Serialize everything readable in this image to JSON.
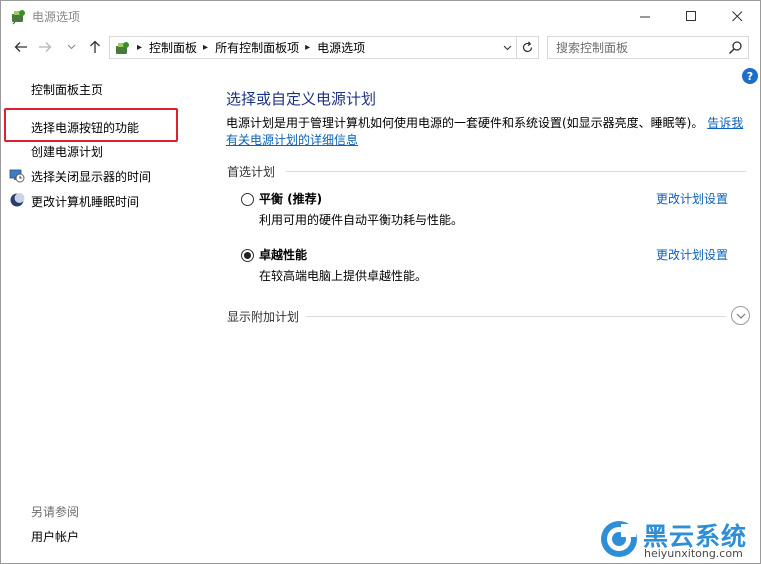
{
  "window": {
    "title": "电源选项",
    "icon": "power-options-icon"
  },
  "address_bar": {
    "breadcrumbs": [
      "控制面板",
      "所有控制面板项",
      "电源选项"
    ],
    "search_placeholder": "搜索控制面板"
  },
  "sidebar": {
    "home": "控制面板主页",
    "links": [
      {
        "label": "选择电源按钮的功能",
        "highlighted": true
      },
      {
        "label": "创建电源计划"
      },
      {
        "label": "选择关闭显示器的时间",
        "icon": "monitor-clock-icon"
      },
      {
        "label": "更改计算机睡眠时间",
        "icon": "moon-icon"
      }
    ],
    "see_also_label": "另请参阅",
    "see_also_items": [
      "用户帐户"
    ]
  },
  "main": {
    "title": "选择或自定义电源计划",
    "description": "电源计划是用于管理计算机如何使用电源的一套硬件和系统设置(如显示器亮度、睡眠等)。",
    "description_link": "告诉我有关电源计划的详细信息",
    "preferred_plans_label": "首选计划",
    "plans": [
      {
        "name": "平衡 (推荐)",
        "description": "利用可用的硬件自动平衡功耗与性能。",
        "selected": false,
        "link": "更改计划设置"
      },
      {
        "name": "卓越性能",
        "description": "在较高端电脑上提供卓越性能。",
        "selected": true,
        "link": "更改计划设置"
      }
    ],
    "additional_plans_label": "显示附加计划"
  },
  "watermark": {
    "name": "黑云系统",
    "url": "heiyunxitong.com"
  },
  "colors": {
    "link": "#0b62b8",
    "title": "#1e3287",
    "highlight": "#e0202a",
    "help": "#1c6fc4",
    "watermark": "#2f8fd6"
  }
}
